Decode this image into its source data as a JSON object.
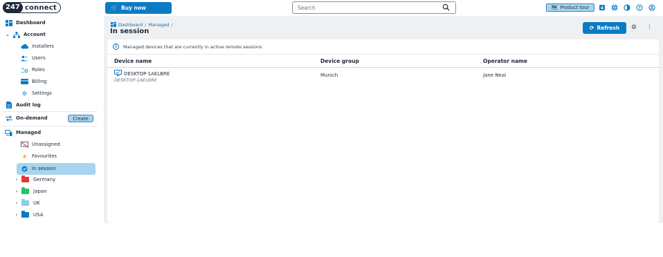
{
  "brand": {
    "logo_num": "247",
    "logo_word": "connect"
  },
  "topbar": {
    "buy_label": "Buy now",
    "search_placeholder": "Search",
    "tour_label": "Product tour"
  },
  "sidebar": {
    "dashboard": "Dashboard",
    "account": "Account",
    "installers": "Installers",
    "users": "Users",
    "roles": "Roles",
    "billing": "Billing",
    "settings": "Settings",
    "audit_log": "Audit log",
    "on_demand": "On-demand",
    "create": "Create",
    "managed": "Managed",
    "unassigned": "Unassigned",
    "favourites": "Favourites",
    "in_session": "In session",
    "groups": [
      {
        "label": "Germany",
        "color": "#e53935"
      },
      {
        "label": "Japan",
        "color": "#22c55e"
      },
      {
        "label": "UK",
        "color": "#8ec9ee"
      },
      {
        "label": "USA",
        "color": "#0b7bc5"
      }
    ]
  },
  "main": {
    "breadcrumb": [
      "Dashboard",
      "Managed"
    ],
    "title": "In session",
    "refresh_label": "Refresh",
    "info_text": "Managed devices that are currently in active remote sessions",
    "columns": [
      "Device name",
      "Device group",
      "Operator name"
    ],
    "rows": [
      {
        "device_name": "DESKTOP-1AELBRE",
        "device_sub": "DESKTOP-1AELBRE",
        "group": "Munich",
        "operator": "Jane Neal"
      }
    ]
  },
  "colors": {
    "accent": "#0b7bc5",
    "selected": "#a8d4ef"
  }
}
